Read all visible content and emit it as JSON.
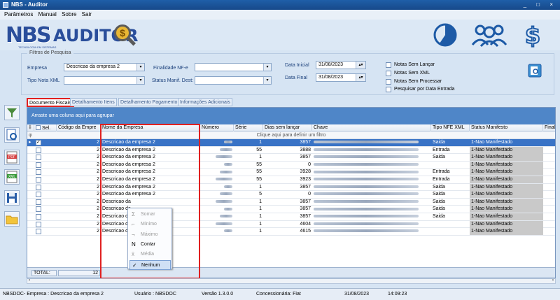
{
  "window": {
    "title": "NBS - Auditor",
    "controls": "_ □ ×"
  },
  "menu": [
    "Parâmetros",
    "Manual",
    "Sobre",
    "Sair"
  ],
  "logo": {
    "brand": "NBS",
    "product": "AUDITOR",
    "coin": "$",
    "tagline": "TECNOLOGIA EM SISTEMAS"
  },
  "filters": {
    "legend": "Filtros de Pesquisa",
    "empresa_label": "Empresa",
    "empresa_value": "Descricao da empresa 2",
    "tipo_nota_label": "Tipo Nota XML",
    "finalidade_label": "Finalidade NF-e",
    "status_manif_label": "Status Manif. Dest:",
    "data_inicial_label": "Data Inicial",
    "data_inicial_value": "31/08/2023",
    "data_final_label": "Data Final",
    "data_final_value": "31/08/2023",
    "checks": [
      "Notas Sem Lançar",
      "Notas Sem XML",
      "Notas Sem Processar",
      "Pesquisar por Data Entrada"
    ]
  },
  "tabs": [
    "Documento Fiscais",
    "Detalhamento Itens",
    "Detalhamento Pagamento",
    "Informações Adicionais"
  ],
  "grid": {
    "group_hint": "Arraste uma coluna aqui para agrupar",
    "filter_hint": "Clique aqui para definir um filtro",
    "columns": [
      "Sel.",
      "Código da Empre",
      "Nome da Empresa",
      "Número",
      "Série",
      "Dias sem lançar",
      "Chave",
      "Tipo  NFE  XML",
      "Status Manifesto",
      "Final"
    ],
    "rows": [
      {
        "codigo": "2",
        "nome": "Descricao da empresa 2",
        "serie": "1",
        "dias": "3857",
        "tipo": "Saida",
        "status": "1-Nao Manifestado",
        "selected": true
      },
      {
        "codigo": "2",
        "nome": "Descricao da empresa 2",
        "serie": "55",
        "dias": "3888",
        "tipo": "Entrada",
        "status": "1-Nao Manifestado",
        "selected": false
      },
      {
        "codigo": "2",
        "nome": "Descricao da empresa 2",
        "serie": "1",
        "dias": "3857",
        "tipo": "Saida",
        "status": "1-Nao Manifestado",
        "selected": false
      },
      {
        "codigo": "2",
        "nome": "Descricao da empresa 2",
        "serie": "55",
        "dias": "0",
        "tipo": "",
        "status": "1-Nao Manifestado",
        "selected": false
      },
      {
        "codigo": "2",
        "nome": "Descricao da empresa 2",
        "serie": "55",
        "dias": "3928",
        "tipo": "Entrada",
        "status": "1-Nao Manifestado",
        "selected": false
      },
      {
        "codigo": "2",
        "nome": "Descricao da empresa 2",
        "serie": "55",
        "dias": "3923",
        "tipo": "Entrada",
        "status": "1-Nao Manifestado",
        "selected": false
      },
      {
        "codigo": "2",
        "nome": "Descricao da empresa 2",
        "serie": "1",
        "dias": "3857",
        "tipo": "Saida",
        "status": "1-Nao Manifestado",
        "selected": false
      },
      {
        "codigo": "2",
        "nome": "Descricao da empresa 2",
        "serie": "5",
        "dias": "0",
        "tipo": "Saida",
        "status": "1-Nao Manifestado",
        "selected": false
      },
      {
        "codigo": "2",
        "nome": "Descricao da",
        "serie": "1",
        "dias": "3857",
        "tipo": "Saida",
        "status": "1-Nao Manifestado",
        "selected": false
      },
      {
        "codigo": "2",
        "nome": "Descricao da",
        "serie": "1",
        "dias": "3857",
        "tipo": "Saida",
        "status": "1-Nao Manifestado",
        "selected": false
      },
      {
        "codigo": "2",
        "nome": "Descricao da",
        "serie": "1",
        "dias": "3857",
        "tipo": "Saida",
        "status": "1-Nao Manifestado",
        "selected": false
      },
      {
        "codigo": "2",
        "nome": "Descricao da",
        "serie": "1",
        "dias": "4604",
        "tipo": "",
        "status": "1-Nao Manifestado",
        "selected": false
      },
      {
        "codigo": "2",
        "nome": "Descricao da",
        "serie": "1",
        "dias": "4615",
        "tipo": "",
        "status": "1-Nao Manifestado",
        "selected": false
      }
    ],
    "total_label": "TOTAL:",
    "total_value": "12"
  },
  "context_menu": [
    {
      "label": "Somar",
      "enabled": false,
      "checked": false,
      "icon": "Σ"
    },
    {
      "label": "Mínimo",
      "enabled": false,
      "checked": false,
      "icon": "⌐"
    },
    {
      "label": "Máximo",
      "enabled": false,
      "checked": false,
      "icon": "¬"
    },
    {
      "label": "Contar",
      "enabled": true,
      "checked": false,
      "icon": "N"
    },
    {
      "label": "Média",
      "enabled": false,
      "checked": false,
      "icon": "x̄"
    },
    {
      "label": "Nenhum",
      "enabled": true,
      "checked": true,
      "icon": "✓"
    }
  ],
  "statusbar": {
    "empresa": "NBSDOC- Empresa : Descricao da empresa 2",
    "usuario": "Usuário : NBSDOC",
    "versao": "Versão 1.3.0.0",
    "concessionaria": "Concessionária: Fiat",
    "data": "31/08/2023",
    "hora": "14:09:23"
  },
  "colors": {
    "titlebar": "#1f5fa8",
    "group_bar": "#4f86c8",
    "selection": "#3973c6",
    "highlight": "#e02020"
  }
}
